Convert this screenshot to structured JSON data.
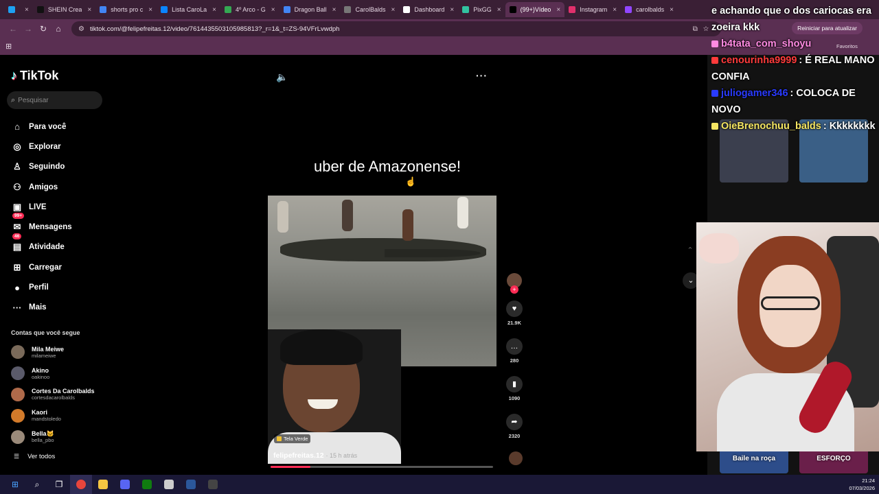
{
  "browser": {
    "tabs": [
      {
        "label": "",
        "color": "#1da1f2",
        "active": false
      },
      {
        "label": "SHEIN Crea",
        "color": "#111111",
        "active": false
      },
      {
        "label": "shorts pro c",
        "color": "#4285f4",
        "active": false
      },
      {
        "label": "Lista CaroLa",
        "color": "#0a84ff",
        "active": false
      },
      {
        "label": "4º Arco - G",
        "color": "#34a853",
        "active": false
      },
      {
        "label": "Dragon Ball",
        "color": "#4285f4",
        "active": false
      },
      {
        "label": "CarolBalds",
        "color": "#777777",
        "active": false
      },
      {
        "label": "Dashboard",
        "color": "#ffffff",
        "active": false
      },
      {
        "label": "PixGG",
        "color": "#32c2a0",
        "active": false
      },
      {
        "label": "(99+)Vídeo",
        "color": "#000000",
        "active": true
      },
      {
        "label": "Instagram",
        "color": "#e1306c",
        "active": false
      },
      {
        "label": "carolbalds",
        "color": "#9146ff",
        "active": false
      }
    ],
    "url": "tiktok.com/@felipefreitas.12/video/7614435503105985813?_r=1&_t=ZS-94VFrLvwdph",
    "restart_label": "Reiniciar para atualizar",
    "favorites_label": "Favoritos"
  },
  "tiktok": {
    "logo": "TikTok",
    "search_placeholder": "Pesquisar",
    "nav": [
      {
        "label": "Para você",
        "icon": "home-icon",
        "glyph": "⌂"
      },
      {
        "label": "Explorar",
        "icon": "compass-icon",
        "glyph": "◎"
      },
      {
        "label": "Seguindo",
        "icon": "following-icon",
        "glyph": "♙"
      },
      {
        "label": "Amigos",
        "icon": "friends-icon",
        "glyph": "⚇"
      },
      {
        "label": "LIVE",
        "icon": "live-icon",
        "glyph": "▣"
      },
      {
        "label": "Mensagens",
        "icon": "messages-icon",
        "glyph": "✉",
        "badge": "99+"
      },
      {
        "label": "Atividade",
        "icon": "activity-icon",
        "glyph": "▤",
        "badge": "46"
      },
      {
        "label": "Carregar",
        "icon": "upload-icon",
        "glyph": "⊞"
      },
      {
        "label": "Perfil",
        "icon": "profile-icon",
        "glyph": "●"
      },
      {
        "label": "Mais",
        "icon": "more-icon",
        "glyph": "···"
      }
    ],
    "following_heading": "Contas que você segue",
    "following": [
      {
        "name": "Mila Meiwe",
        "handle": "milameiwe",
        "color": "#7a6a5a"
      },
      {
        "name": "Akino",
        "handle": "oakinoo",
        "color": "#5a5a6a"
      },
      {
        "name": "Cortes Da Carolbalds",
        "handle": "cortesdacarolbalds",
        "color": "#b06a4a"
      },
      {
        "name": "Kaori",
        "handle": "mandstoledo",
        "color": "#d27a2a"
      },
      {
        "name": "Bella🐱",
        "handle": "bella_pbo",
        "color": "#9a8a7a"
      }
    ],
    "see_all": "Ver todos"
  },
  "video": {
    "caption": "uber de Amazonense!",
    "sticker": "Tela Verde",
    "author": "felipefreitas.12",
    "posted": "· 15 h atrás",
    "progress": 0.18,
    "actions": [
      {
        "name": "like",
        "icon": "heart-icon",
        "glyph": "♥",
        "count": "21.9K"
      },
      {
        "name": "comment",
        "icon": "comment-icon",
        "glyph": "…",
        "count": "280"
      },
      {
        "name": "save",
        "icon": "bookmark-icon",
        "glyph": "▮",
        "count": "1090"
      },
      {
        "name": "share",
        "icon": "share-icon",
        "glyph": "➦",
        "count": "2320"
      }
    ]
  },
  "right_panel": {
    "thumbs": [
      {
        "label": "",
        "color": "#3b3f4e"
      },
      {
        "label": "",
        "color": "#3a5f86"
      },
      {
        "label": "Baile na roça",
        "color": "#2d4d8a"
      },
      {
        "label": "ESFORÇO",
        "color": "#6a1f4a"
      }
    ]
  },
  "chat": [
    {
      "user": "",
      "text": "e achando que o dos cariocas era zoeira kkk",
      "color": "#ffffff"
    },
    {
      "user": "b4tata_com_shoyu",
      "text": "",
      "color": "#ff8ae2"
    },
    {
      "user": "cenourinha9999",
      "text": ": É REAL MANO CONFIA",
      "color": "#ff3b3b"
    },
    {
      "user": "juliogamer346",
      "text": ": COLOCA DE NOVO",
      "color": "#2a3bff"
    },
    {
      "user": "OieBrenochuu_balds",
      "text": ": Kkkkkkkk",
      "color": "#f5e663"
    }
  ],
  "taskbar": {
    "apps": [
      {
        "icon": "windows-icon",
        "glyph": "⊞",
        "color": "#4aa3ff"
      },
      {
        "icon": "search-icon",
        "glyph": "⌕",
        "color": ""
      },
      {
        "icon": "taskview-icon",
        "glyph": "❐",
        "color": ""
      },
      {
        "icon": "chrome-icon",
        "glyph": "",
        "color": "#e8453c"
      },
      {
        "icon": "folder-icon",
        "glyph": "",
        "color": "#f4c542"
      },
      {
        "icon": "discord-icon",
        "glyph": "",
        "color": "#5865f2"
      },
      {
        "icon": "xbox-icon",
        "glyph": "",
        "color": "#107c10"
      },
      {
        "icon": "shield-icon",
        "glyph": "",
        "color": "#cccccc"
      },
      {
        "icon": "word-icon",
        "glyph": "",
        "color": "#2b579a"
      },
      {
        "icon": "obs-icon",
        "glyph": "",
        "color": "#444444"
      }
    ],
    "time": "21:24",
    "date": "07/03/2026"
  }
}
